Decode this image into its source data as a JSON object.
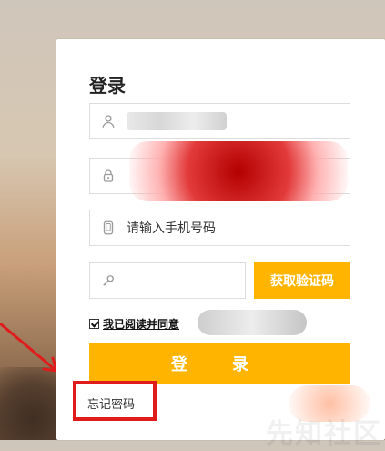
{
  "title": "登录",
  "fields": {
    "username": {
      "value": ""
    },
    "password": {
      "value": ""
    },
    "phone": {
      "placeholder": "请输入手机号码"
    },
    "code": {
      "placeholder": ""
    }
  },
  "buttons": {
    "get_code": "获取验证码",
    "login": "登 录"
  },
  "agreement": {
    "text": "我已阅读并同意"
  },
  "links": {
    "forgot_password": "忘记密码"
  },
  "watermark": "先知社区",
  "colors": {
    "primary": "#ffb400",
    "highlight_red": "#e01b1b"
  },
  "icons": {
    "user": "user-icon",
    "lock": "lock-icon",
    "phone": "phone-icon",
    "key": "key-icon"
  }
}
